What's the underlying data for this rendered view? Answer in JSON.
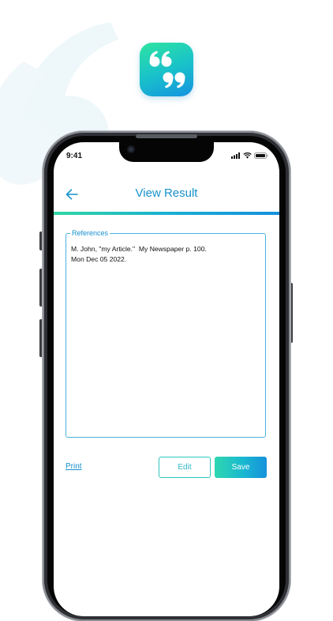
{
  "colors": {
    "accent": "#1691cc",
    "gradient_start": "#2fd7a3",
    "gradient_end": "#1490dc"
  },
  "app_icon": {
    "icon": "quote-marks-icon"
  },
  "status_bar": {
    "time": "9:41",
    "icons": [
      "signal-icon",
      "wifi-icon",
      "battery-icon"
    ]
  },
  "header": {
    "title": "View Result",
    "back_icon": "arrow-left-icon"
  },
  "references": {
    "label": "References",
    "lines": [
      "M. John, \"my Article.\"  My Newspaper p. 100.",
      "Mon Dec 05 2022."
    ]
  },
  "actions": {
    "print_label": "Print",
    "edit_label": "Edit",
    "save_label": "Save"
  }
}
